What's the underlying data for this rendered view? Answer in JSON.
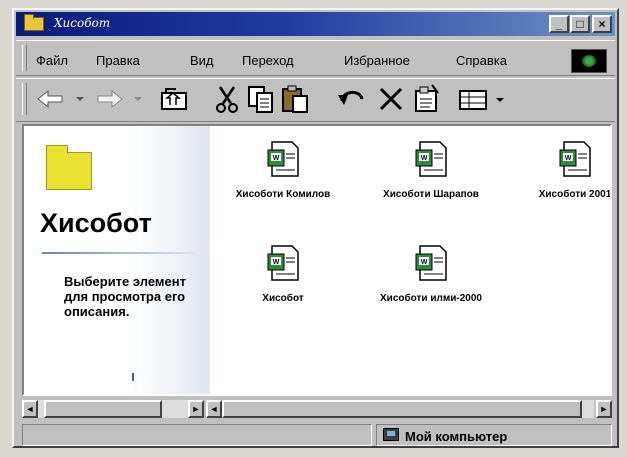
{
  "window": {
    "title": "Хисобот"
  },
  "menu": [
    "Файл",
    "Правка",
    "Вид",
    "Переход",
    "Избранное",
    "Справка"
  ],
  "toolbar_icons": [
    "back-icon",
    "forward-icon",
    "up-folder-icon",
    "cut-icon",
    "copy-icon",
    "paste-icon",
    "undo-icon",
    "delete-icon",
    "properties-icon",
    "views-icon"
  ],
  "left_pane": {
    "folder_title": "Хисобот",
    "description": "Выберите элемент для просмотра его описания."
  },
  "files": [
    {
      "label": "Хисоботи Комилов"
    },
    {
      "label": "Хисоботи Шарапов"
    },
    {
      "label": "Хисоботи 2001"
    },
    {
      "label": "Хисобот"
    },
    {
      "label": "Хисоботи илми-2000"
    }
  ],
  "status": {
    "location": "Мой компьютер"
  },
  "colors": {
    "title_bar": "#0a1a7a",
    "folder": "#e9e233",
    "document_icon": "#2e8a3c"
  }
}
